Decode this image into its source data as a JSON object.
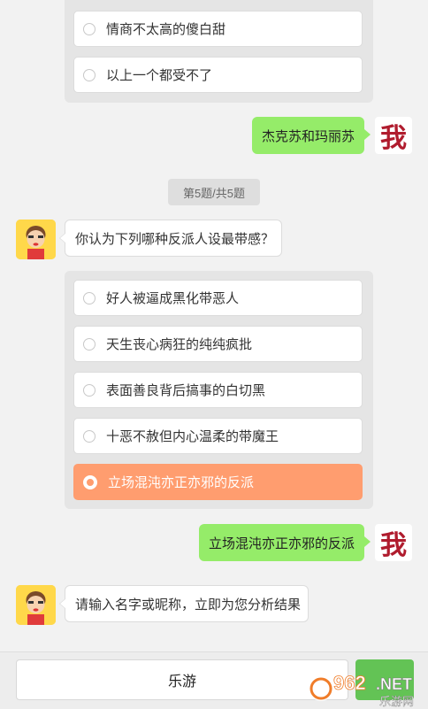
{
  "prev_question": {
    "options": [
      {
        "label": "情商不太高的傻白甜"
      },
      {
        "label": "以上一个都受不了"
      }
    ]
  },
  "prev_answer": {
    "text": "杰克苏和玛丽苏"
  },
  "me_avatar": {
    "glyph": "我"
  },
  "progress": {
    "text": "第5题/共5题"
  },
  "question": {
    "text": "你认为下列哪种反派人设最带感？"
  },
  "options": [
    {
      "label": "好人被逼成黑化带恶人",
      "selected": false
    },
    {
      "label": "天生丧心病狂的纯纯疯批",
      "selected": false
    },
    {
      "label": "表面善良背后搞事的白切黑",
      "selected": false
    },
    {
      "label": "十恶不赦但内心温柔的带魔王",
      "selected": false
    },
    {
      "label": "立场混沌亦正亦邪的反派",
      "selected": true
    }
  ],
  "answer": {
    "text": "立场混沌亦正亦邪的反派"
  },
  "prompt": {
    "text": "请输入名字或昵称，立即为您分析结果"
  },
  "input": {
    "value": "乐游"
  },
  "watermark": {
    "main": "962",
    "suffix": ".NET",
    "sub": "乐游网"
  },
  "colors": {
    "accent": "#ff9d6f",
    "chat_green": "#95ec69",
    "send_green": "#63c355",
    "avatar_red": "#b01c2e"
  }
}
